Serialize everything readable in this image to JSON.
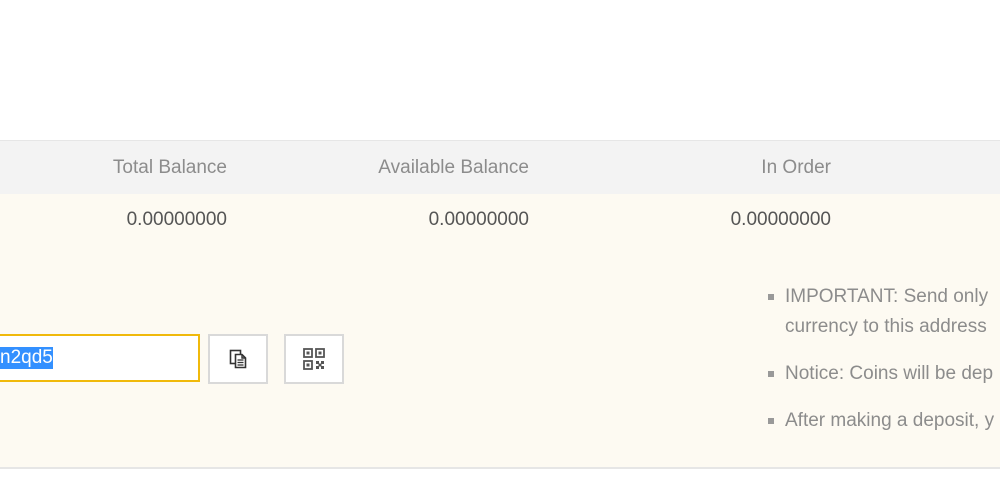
{
  "table": {
    "headers": {
      "total": "Total Balance",
      "available": "Available Balance",
      "in_order": "In Order"
    },
    "row": {
      "total": "0.00000000",
      "available": "0.00000000",
      "in_order": "0.00000000"
    }
  },
  "deposit": {
    "address_value": "n2qd5",
    "copy_icon": "copy-document-icon",
    "qr_icon": "qr-code-icon",
    "notes": [
      {
        "line1": "IMPORTANT: Send only",
        "line2": "currency to this address"
      },
      {
        "line1": "Notice: Coins will be dep",
        "line2": ""
      },
      {
        "line1": "After making a deposit, y",
        "line2": ""
      }
    ]
  },
  "colors": {
    "accent_border": "#f0b90b",
    "selection": "#3390ff",
    "panel_background": "#fdfaf2",
    "header_background": "#f3f3f3"
  }
}
